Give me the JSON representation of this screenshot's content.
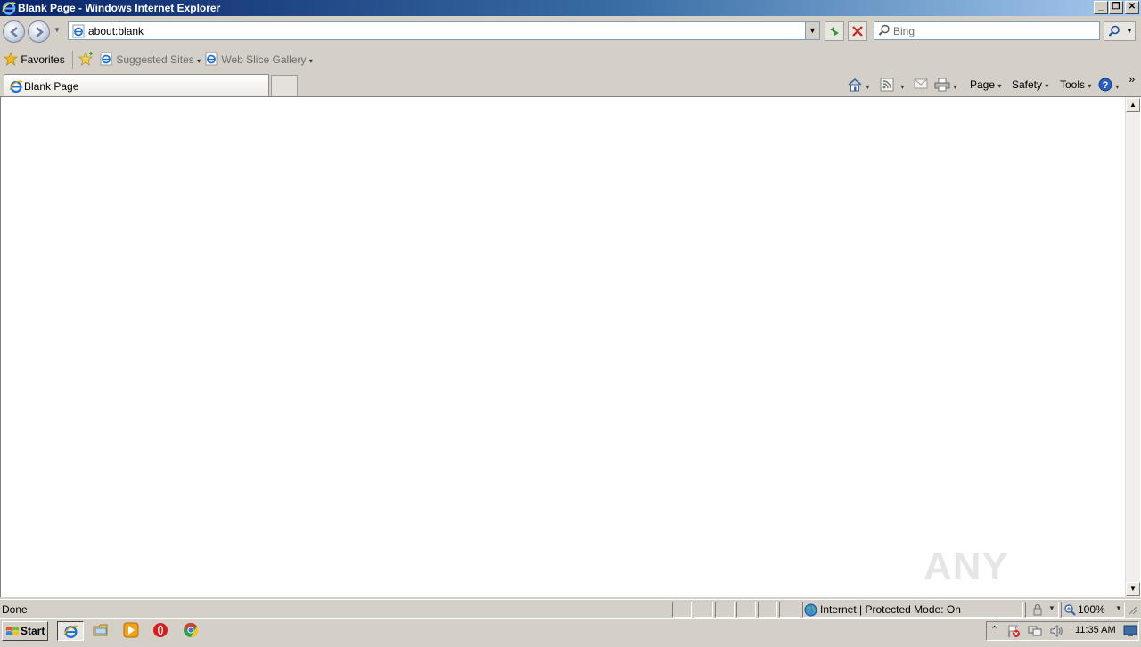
{
  "window": {
    "title": "Blank Page - Windows Internet Explorer",
    "minimize_glyph": "_",
    "restore_glyph": "❐",
    "close_glyph": "✕"
  },
  "address_bar": {
    "url": "about:blank",
    "dropdown_glyph": "▼"
  },
  "search": {
    "placeholder": "Bing"
  },
  "favorites_bar": {
    "favorites_label": "Favorites",
    "suggested_sites_label": "Suggested Sites",
    "web_slice_gallery_label": "Web Slice Gallery",
    "caret": "▾"
  },
  "tabs": [
    {
      "label": "Blank Page"
    }
  ],
  "command_bar": {
    "page_label": "Page",
    "safety_label": "Safety",
    "tools_label": "Tools",
    "caret": "▾",
    "chevron": "»"
  },
  "status_bar": {
    "status_text": "Done",
    "zone_text": "Internet | Protected Mode: On",
    "zoom_text": "100%"
  },
  "taskbar": {
    "start_label": "Start",
    "clock": "11:35 AM"
  },
  "watermark": {
    "text": "ANY RUN"
  },
  "colors": {
    "title_gradient_start": "#0a246a",
    "title_gradient_end": "#a6caf0",
    "chrome": "#d4d0c8",
    "content_bg": "#ffffff",
    "ie_blue": "#1c6fd6"
  },
  "icons": {
    "title": "ie-logo-icon",
    "back": "back-arrow-icon",
    "forward": "forward-arrow-icon",
    "refresh": "refresh-icon",
    "stop": "stop-icon",
    "search": "magnifier-icon",
    "favorites": "star-icon",
    "home": "home-icon",
    "feeds": "rss-icon",
    "mail": "mail-icon",
    "print": "printer-icon",
    "help": "help-icon"
  }
}
